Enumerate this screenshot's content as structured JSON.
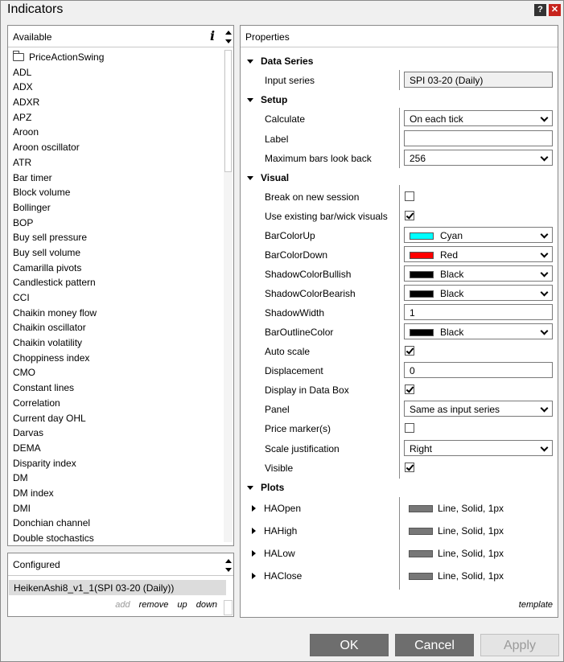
{
  "window": {
    "title": "Indicators",
    "help_glyph": "?",
    "close_glyph": "✕"
  },
  "available": {
    "header": "Available",
    "info_glyph": "i",
    "items": [
      "PriceActionSwing",
      "ADL",
      "ADX",
      "ADXR",
      "APZ",
      "Aroon",
      "Aroon oscillator",
      "ATR",
      "Bar timer",
      "Block volume",
      "Bollinger",
      "BOP",
      "Buy sell pressure",
      "Buy sell volume",
      "Camarilla pivots",
      "Candlestick pattern",
      "CCI",
      "Chaikin money flow",
      "Chaikin oscillator",
      "Chaikin volatility",
      "Choppiness index",
      "CMO",
      "Constant lines",
      "Correlation",
      "Current day OHL",
      "Darvas",
      "DEMA",
      "Disparity index",
      "DM",
      "DM index",
      "DMI",
      "Donchian channel",
      "Double stochastics"
    ]
  },
  "configured": {
    "header": "Configured",
    "item": "HeikenAshi8_v1_1(SPI 03-20 (Daily))",
    "actions": {
      "add": "add",
      "remove": "remove",
      "up": "up",
      "down": "down"
    }
  },
  "properties": {
    "header": "Properties",
    "template_link": "template",
    "sections": {
      "data_series": "Data Series",
      "setup": "Setup",
      "visual": "Visual",
      "plots": "Plots"
    },
    "input_series": {
      "label": "Input series",
      "value": "SPI 03-20 (Daily)"
    },
    "calculate": {
      "label": "Calculate",
      "value": "On each tick"
    },
    "label_field": {
      "label": "Label",
      "value": ""
    },
    "max_bars": {
      "label": "Maximum bars look back",
      "value": "256"
    },
    "break_new_session": {
      "label": "Break on new session",
      "checked": false
    },
    "use_existing": {
      "label": "Use existing bar/wick visuals",
      "checked": true
    },
    "bar_color_up": {
      "label": "BarColorUp",
      "value": "Cyan",
      "color": "#00ffff"
    },
    "bar_color_down": {
      "label": "BarColorDown",
      "value": "Red",
      "color": "#ff0000"
    },
    "shadow_bullish": {
      "label": "ShadowColorBullish",
      "value": "Black",
      "color": "#000000"
    },
    "shadow_bearish": {
      "label": "ShadowColorBearish",
      "value": "Black",
      "color": "#000000"
    },
    "shadow_width": {
      "label": "ShadowWidth",
      "value": "1"
    },
    "bar_outline": {
      "label": "BarOutlineColor",
      "value": "Black",
      "color": "#000000"
    },
    "auto_scale": {
      "label": "Auto scale",
      "checked": true
    },
    "displacement": {
      "label": "Displacement",
      "value": "0"
    },
    "display_data_box": {
      "label": "Display in Data Box",
      "checked": true
    },
    "panel": {
      "label": "Panel",
      "value": "Same as input series"
    },
    "price_marker": {
      "label": "Price marker(s)",
      "checked": false
    },
    "scale_just": {
      "label": "Scale justification",
      "value": "Right"
    },
    "visible": {
      "label": "Visible",
      "checked": true
    },
    "plots": [
      {
        "label": "HAOpen",
        "value": "Line, Solid, 1px"
      },
      {
        "label": "HAHigh",
        "value": "Line, Solid, 1px"
      },
      {
        "label": "HALow",
        "value": "Line, Solid, 1px"
      },
      {
        "label": "HAClose",
        "value": "Line, Solid, 1px"
      }
    ]
  },
  "buttons": {
    "ok": "OK",
    "cancel": "Cancel",
    "apply": "Apply"
  }
}
